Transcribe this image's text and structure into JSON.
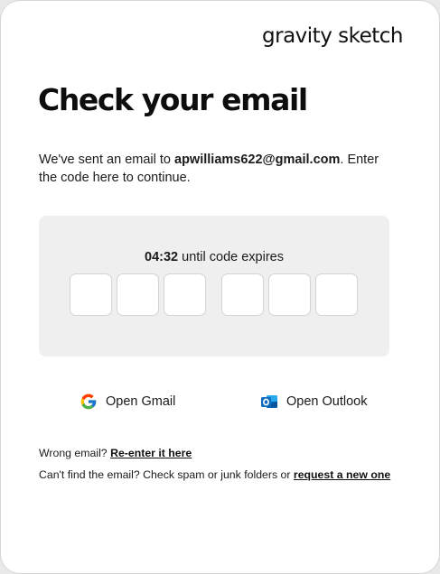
{
  "brand": {
    "logo_text": "gravity sketch"
  },
  "page": {
    "title": "Check your email"
  },
  "intro": {
    "prefix": "We've sent an email to ",
    "email": "apwilliams622@gmail.com",
    "suffix": ". Enter the code here to continue."
  },
  "code": {
    "time_remaining": "04:32",
    "expires_text": " until code expires",
    "digits": [
      "",
      "",
      "",
      "",
      "",
      ""
    ]
  },
  "email_apps": {
    "gmail_label": "Open Gmail",
    "gmail_icon": "google-g-icon",
    "outlook_label": "Open Outlook",
    "outlook_icon": "outlook-icon"
  },
  "help": {
    "wrong_email_prefix": "Wrong email? ",
    "wrong_email_link": "Re-enter it here",
    "cant_find_prefix": "Can't find the email? Check spam or junk folders or ",
    "cant_find_link": "request a new one"
  },
  "colors": {
    "panel_background": "#efefef",
    "google_blue": "#4285F4",
    "google_red": "#EA4335",
    "google_yellow": "#FBBC05",
    "google_green": "#34A853",
    "outlook_blue": "#0F6CBD"
  }
}
